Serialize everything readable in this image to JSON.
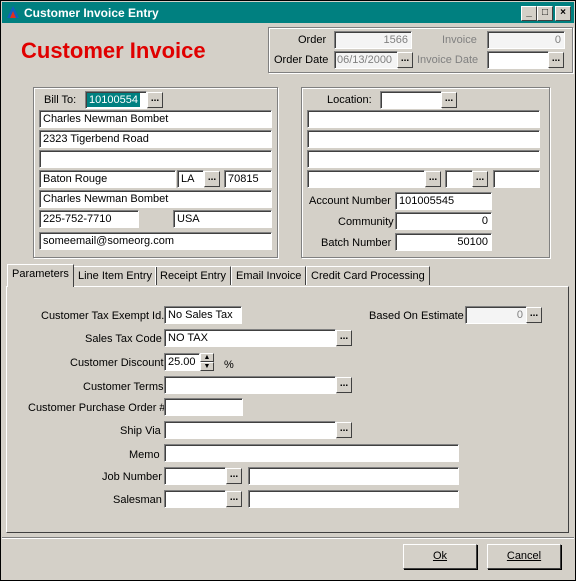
{
  "window": {
    "title": "Customer Invoice Entry",
    "heading": "Customer Invoice",
    "buttons": {
      "minimize": "_",
      "maximize": "□",
      "close": "×"
    }
  },
  "header": {
    "order_label": "Order",
    "order_value": "1566",
    "order_date_label": "Order Date",
    "order_date_value": "06/13/2000",
    "invoice_label": "Invoice",
    "invoice_value": "0",
    "invoice_date_label": "Invoice Date",
    "invoice_date_value": ""
  },
  "bill_to": {
    "label": "Bill To:",
    "customer_id": "10100554",
    "name": "Charles Newman Bombet",
    "address1": "2323 Tigerbend Road",
    "address2": "",
    "city": "Baton Rouge",
    "state": "LA",
    "zip": "70815",
    "contact": "Charles Newman Bombet",
    "phone": "225-752-7710",
    "country": "USA",
    "email": "someemail@someorg.com"
  },
  "location": {
    "label": "Location:",
    "value": "",
    "line1": "",
    "line2": "",
    "line3": "",
    "city": "",
    "state": "",
    "zip": "",
    "account_number_label": "Account Number",
    "account_number": "101005545",
    "community_label": "Community",
    "community": "0",
    "batch_number_label": "Batch Number",
    "batch_number": "50100"
  },
  "tabs": [
    {
      "label": "Parameters"
    },
    {
      "label": "Line Item Entry"
    },
    {
      "label": "Receipt Entry"
    },
    {
      "label": "Email Invoice"
    },
    {
      "label": "Credit Card Processing"
    }
  ],
  "parameters": {
    "tax_exempt_label": "Customer Tax Exempt Id.",
    "tax_exempt_value": "No Sales Tax",
    "based_on_estimate_label": "Based On Estimate",
    "based_on_estimate_value": "0",
    "sales_tax_code_label": "Sales Tax Code",
    "sales_tax_code_value": "NO TAX",
    "discount_label": "Customer Discount",
    "discount_value": "25.00",
    "discount_unit": "%",
    "terms_label": "Customer Terms",
    "terms_value": "",
    "po_label": "Customer Purchase Order #",
    "po_value": "",
    "ship_via_label": "Ship Via",
    "ship_via_value": "",
    "memo_label": "Memo",
    "memo_value": "",
    "job_number_label": "Job Number",
    "job_number_value": "",
    "job_number_desc": "",
    "salesman_label": "Salesman",
    "salesman_value": "",
    "salesman_desc": ""
  },
  "footer": {
    "ok_label": "Ok",
    "cancel_label": "Cancel"
  },
  "ellipsis": "..."
}
